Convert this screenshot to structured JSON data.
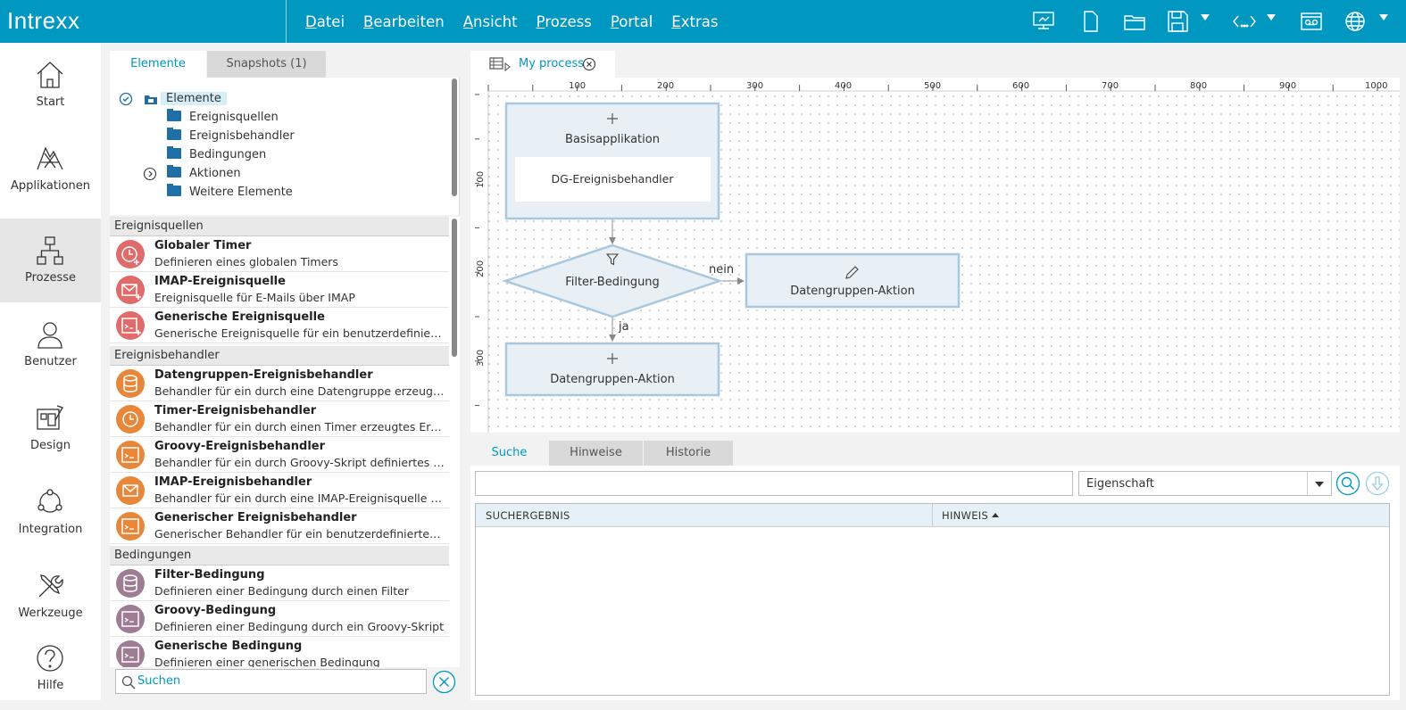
{
  "topbar": {
    "logo": "Intrexx",
    "menu": [
      {
        "accel": "D",
        "rest": "atei"
      },
      {
        "accel": "B",
        "rest": "earbeiten"
      },
      {
        "accel": "A",
        "rest": "nsicht"
      },
      {
        "accel": "P",
        "rest": "rozess"
      },
      {
        "accel": "P",
        "rest": "ortal"
      },
      {
        "accel": "E",
        "rest": "xtras"
      }
    ],
    "icons": [
      "presentation-icon",
      "new-document-icon",
      "open-folder-icon",
      "save-icon",
      "code-icon",
      "cassette-icon",
      "globe-icon"
    ]
  },
  "nav": [
    {
      "label": "Start",
      "icon": "home-icon"
    },
    {
      "label": "Applikationen",
      "icon": "applications-icon"
    },
    {
      "label": "Prozesse",
      "icon": "processes-icon",
      "active": true
    },
    {
      "label": "Benutzer",
      "icon": "user-icon"
    },
    {
      "label": "Design",
      "icon": "design-icon"
    },
    {
      "label": "Integration",
      "icon": "integration-icon"
    },
    {
      "label": "Werkzeuge",
      "icon": "tools-icon"
    },
    {
      "label": "Hilfe",
      "icon": "help-icon"
    }
  ],
  "panel": {
    "tabs": [
      "Elemente",
      "Snapshots (1)"
    ],
    "tree": {
      "root": "Elemente",
      "children": [
        "Ereignisquellen",
        "Ereignisbehandler",
        "Bedingungen",
        "Aktionen",
        "Weitere Elemente"
      ]
    },
    "sections": [
      {
        "title": "Ereignisquellen",
        "items": [
          {
            "name": "Globaler Timer",
            "desc": "Definieren eines globalen Timers",
            "color": "#e06b6b"
          },
          {
            "name": "IMAP-Ereignisquelle",
            "desc": "Ereignisquelle für E-Mails über IMAP",
            "color": "#e06b6b"
          },
          {
            "name": "Generische Ereignisquelle",
            "desc": "Generische Ereignisquelle für ein benutzerdefiniertes...",
            "color": "#e06b6b"
          }
        ]
      },
      {
        "title": "Ereignisbehandler",
        "items": [
          {
            "name": "Datengruppen-Ereignisbehandler",
            "desc": "Behandler für ein durch eine Datengruppe erzeugtes...",
            "color": "#e8873a"
          },
          {
            "name": "Timer-Ereignisbehandler",
            "desc": "Behandler für ein durch einen Timer erzeugtes Ereig...",
            "color": "#e8873a"
          },
          {
            "name": "Groovy-Ereignisbehandler",
            "desc": "Behandler für ein durch Groovy-Skript definiertes Ere...",
            "color": "#e8873a"
          },
          {
            "name": "IMAP-Ereignisbehandler",
            "desc": "Behandler für ein durch eine IMAP-Ereignisquelle erz...",
            "color": "#e8873a"
          },
          {
            "name": "Generischer Ereignisbehandler",
            "desc": "Generischer Behandler für ein benutzerdefiniertes Er...",
            "color": "#e8873a"
          }
        ]
      },
      {
        "title": "Bedingungen",
        "items": [
          {
            "name": "Filter-Bedingung",
            "desc": "Definieren einer Bedingung durch einen Filter",
            "color": "#9e7d94"
          },
          {
            "name": "Groovy-Bedingung",
            "desc": "Definieren einer Bedingung durch ein Groovy-Skript",
            "color": "#9e7d94"
          },
          {
            "name": "Generische Bedingung",
            "desc": "Definieren einer generischen Bedingung",
            "color": "#9e7d94"
          }
        ]
      }
    ],
    "search_placeholder": "Suchen"
  },
  "doc": {
    "tab": "My process"
  },
  "canvas": {
    "ruler_x": [
      "100",
      "200",
      "300",
      "400",
      "500",
      "600",
      "700",
      "800",
      "900",
      "1000"
    ],
    "ruler_y": [
      "100",
      "200",
      "300"
    ],
    "nodes": {
      "app_title": "Basisapplikation",
      "app_inner": "DG-Ereignisbehandler",
      "filter": "Filter-Bedingung",
      "action_right": "Datengruppen-Aktion",
      "action_bottom": "Datengruppen-Aktion"
    },
    "edges": {
      "no": "nein",
      "yes": "ja"
    },
    "colors": {
      "border": "#a9c8de",
      "fill": "#e8eff5"
    }
  },
  "bottom": {
    "tabs": [
      "Suche",
      "Hinweise",
      "Historie"
    ],
    "property_select": "Eigenschaft",
    "columns": [
      "SUCHERGEBNIS",
      "HINWEIS"
    ]
  }
}
